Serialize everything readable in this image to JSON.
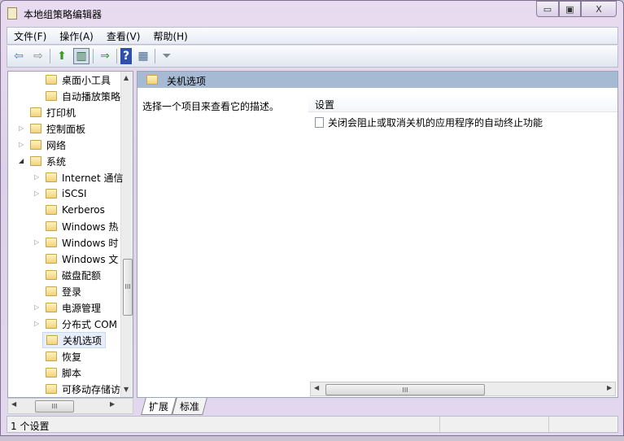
{
  "window": {
    "title": "本地组策略编辑器",
    "min": "▭",
    "max": "▣",
    "close": "X"
  },
  "menu": [
    "文件(F)",
    "操作(A)",
    "查看(V)",
    "帮助(H)"
  ],
  "toolbar": {
    "back": "⇦",
    "forward": "⇨",
    "up": "⬆",
    "show_hide": "▥",
    "export": "⇒",
    "help": "?",
    "properties": "▦",
    "filter": "⏷"
  },
  "tree": [
    {
      "label": "桌面小工具",
      "level": 3,
      "expander": ""
    },
    {
      "label": "自动播放策略",
      "level": 3,
      "expander": ""
    },
    {
      "label": "打印机",
      "level": 2,
      "expander": ""
    },
    {
      "label": "控制面板",
      "level": 2,
      "expander": "▷"
    },
    {
      "label": "网络",
      "level": 2,
      "expander": "▷"
    },
    {
      "label": "系统",
      "level": 2,
      "expander": "◢"
    },
    {
      "label": "Internet 通信",
      "level": 3,
      "expander": "▷"
    },
    {
      "label": "iSCSI",
      "level": 3,
      "expander": "▷"
    },
    {
      "label": "Kerberos",
      "level": 3,
      "expander": ""
    },
    {
      "label": "Windows 热",
      "level": 3,
      "expander": ""
    },
    {
      "label": "Windows 时",
      "level": 3,
      "expander": "▷"
    },
    {
      "label": "Windows 文",
      "level": 3,
      "expander": ""
    },
    {
      "label": "磁盘配额",
      "level": 3,
      "expander": ""
    },
    {
      "label": "登录",
      "level": 3,
      "expander": ""
    },
    {
      "label": "电源管理",
      "level": 3,
      "expander": "▷"
    },
    {
      "label": "分布式 COM",
      "level": 3,
      "expander": "▷"
    },
    {
      "label": "关机选项",
      "level": 3,
      "expander": "",
      "selected": true
    },
    {
      "label": "恢复",
      "level": 3,
      "expander": ""
    },
    {
      "label": "脚本",
      "level": 3,
      "expander": ""
    },
    {
      "label": "可移动存储访",
      "level": 3,
      "expander": ""
    }
  ],
  "panel": {
    "title": "关机选项",
    "description": "选择一个项目来查看它的描述。",
    "column": "设置",
    "items": [
      "关闭会阻止或取消关机的应用程序的自动终止功能"
    ]
  },
  "scroll": {
    "up": "▲",
    "down": "▼",
    "left": "◀",
    "right": "▶",
    "grip": "III"
  },
  "tabs": [
    "扩展",
    "标准"
  ],
  "status": "1 个设置"
}
